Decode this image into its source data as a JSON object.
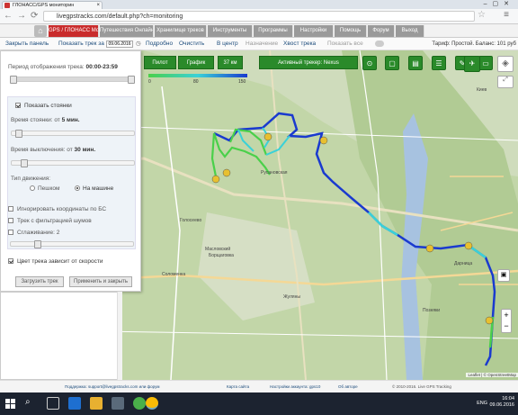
{
  "browser": {
    "tab_title": "ГЛОНАСС/GPS мониторин",
    "url": "livegpstracks.com/default.php?ch=monitoring"
  },
  "site_nav": {
    "items": [
      "GPS / ГЛОНАСС Мониторинг",
      "Путешествия Онлайн",
      "Хранилище треков",
      "Инструменты",
      "Программы",
      "Настройки",
      "Помощь",
      "Форум",
      "Выход"
    ],
    "active_color": "#c92c2c"
  },
  "toolbar": {
    "close_panel": "Закрыть панель",
    "show_track_for": "Показать трек за",
    "date": "09.06.2016",
    "detailed": "Подробно",
    "clear": "Очистить",
    "center": "В центр",
    "bind": "Назначение",
    "track_tail": "Хвост трека",
    "show_all": "Показать все",
    "balance": "Тариф: Простой. Баланс: 101 руб"
  },
  "map_tools": {
    "buttons": [
      "Пилот",
      "График",
      "37 км",
      "Активный трекер: Nexus"
    ],
    "icons": [
      "target-icon",
      "square-icon",
      "document-icon",
      "list-icon",
      "edit-icon",
      "folder-icon",
      "satellite-icon"
    ],
    "legend_ticks": [
      "0",
      "80",
      "150"
    ]
  },
  "panel": {
    "period_label": "Период отображения трека:",
    "period_value": "00:00-23:59",
    "show_stops": "Показать стоянки",
    "stop_time_label": "Время стоянки: от",
    "stop_time_value": "5 мин.",
    "shutdown_time_label": "Время выключения: от",
    "shutdown_time_value": "30 мин.",
    "movement_type": "Тип движения:",
    "walk": "Пешком",
    "car": "На машине",
    "ignore_coords": "Игнорировать координаты по БС",
    "filter_noise": "Трек с фильтрацией шумов",
    "smoothing": "Сглаживание: 2",
    "color_by_speed": "Цвет трека зависит от скорости",
    "load_track": "Загрузить трек",
    "apply_close": "Применить и закрыть"
  },
  "map_labels": {
    "district1": "Русановская",
    "district2": "Дарница",
    "district3": "Жуляны",
    "district4": "Позняки",
    "district5": "Голосеево",
    "district6": "Соломенка",
    "city": "Киев",
    "label_masl": "Масловский",
    "label_bor": "Борщаговка"
  },
  "attribution": "Leaflet | © OpenStreetMap",
  "footer": {
    "support": "Поддержка: support@livegpstracks.com или форум",
    "map_site": "Карта сайта",
    "settings": "Настройки аккаунта: gps10",
    "about": "Об авторе",
    "copyright": "© 2010-2016. Live GPS Tracking"
  },
  "taskbar": {
    "lang": "ENG",
    "time": "16:04",
    "date": "09.06.2016"
  },
  "track_colors": {
    "slow": "#4ad04a",
    "medium": "#3ad1d8",
    "fast": "#1a3acf"
  }
}
